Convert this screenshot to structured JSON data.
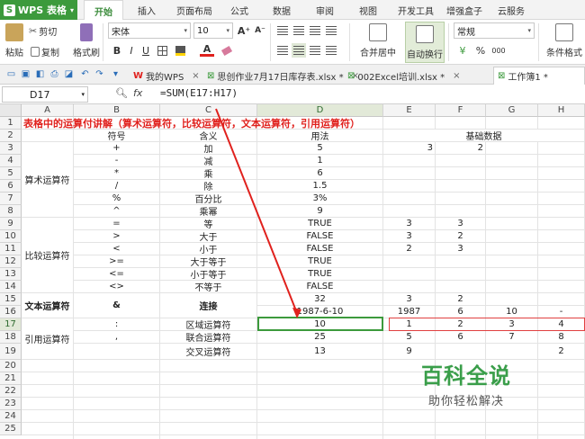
{
  "app": {
    "name": "WPS 表格",
    "logo": "S"
  },
  "menu_tabs": [
    {
      "label": "开始",
      "active": true
    },
    {
      "label": "插入"
    },
    {
      "label": "页面布局"
    },
    {
      "label": "公式"
    },
    {
      "label": "数据"
    },
    {
      "label": "审阅"
    },
    {
      "label": "视图"
    },
    {
      "label": "开发工具"
    },
    {
      "label": "增强盒子"
    },
    {
      "label": "云服务"
    }
  ],
  "ribbon": {
    "paste": "粘贴",
    "cut": "剪切",
    "copy": "复制",
    "format_painter": "格式刷",
    "font_name": "宋体",
    "font_size": "10",
    "grow_font": "A⁺",
    "shrink_font": "A⁻",
    "bold": "B",
    "italic": "I",
    "underline": "U",
    "merge_center": "合并居中",
    "wrap_text": "自动换行",
    "number_format": "常规",
    "percent": "%",
    "thousands": "000",
    "conditional_format": "条件格式"
  },
  "doc_tabs": [
    {
      "label": "我的WPS",
      "closable": true
    },
    {
      "label": "思创作业7月17日库存表.xlsx *",
      "closable": true
    },
    {
      "label": "002Excel培训.xlsx *",
      "closable": true
    },
    {
      "label": "工作簿1 *",
      "closable": false,
      "active": true
    }
  ],
  "formula_bar": {
    "cell": "D17",
    "fx": "fx",
    "formula": "=SUM(E17:H17)"
  },
  "columns": [
    "A",
    "B",
    "C",
    "D",
    "E",
    "F",
    "G",
    "H"
  ],
  "selected_column": "D",
  "rows": [
    "1",
    "2",
    "3",
    "4",
    "5",
    "6",
    "7",
    "8",
    "9",
    "10",
    "11",
    "12",
    "13",
    "14",
    "15",
    "16",
    "17",
    "18",
    "19",
    "20",
    "21",
    "22",
    "23",
    "24",
    "25"
  ],
  "selected_row": "17",
  "sheet": {
    "title": "表格中的运算付讲解（算术运算符，比较运算符，文本运算符，引用运算符）",
    "headers": {
      "symbol": "符号",
      "meaning": "含义",
      "usage": "用法",
      "base": "基础数据"
    },
    "groups": {
      "arith": "算术运算符",
      "compare": "比较运算符",
      "text": "文本运算符",
      "ref": "引用运算符"
    },
    "rows": [
      {
        "r": 3,
        "b": "+",
        "c": "加",
        "d": "5",
        "e": "3",
        "f": "2"
      },
      {
        "r": 4,
        "b": "-",
        "c": "减",
        "d": "1"
      },
      {
        "r": 5,
        "b": "*",
        "c": "乘",
        "d": "6"
      },
      {
        "r": 6,
        "b": "/",
        "c": "除",
        "d": "1.5"
      },
      {
        "r": 7,
        "b": "%",
        "c": "百分比",
        "d": "3%"
      },
      {
        "r": 8,
        "b": "^",
        "c": "乘幂",
        "d": "9"
      },
      {
        "r": 9,
        "b": "=",
        "c": "等",
        "d": "TRUE",
        "e": "3",
        "f": "3"
      },
      {
        "r": 10,
        "b": ">",
        "c": "大于",
        "d": "FALSE",
        "e": "3",
        "f": "2"
      },
      {
        "r": 11,
        "b": "<",
        "c": "小于",
        "d": "FALSE",
        "e": "2",
        "f": "3"
      },
      {
        "r": 12,
        "b": ">=",
        "c": "大于等于",
        "d": "TRUE"
      },
      {
        "r": 13,
        "b": "<=",
        "c": "小于等于",
        "d": "TRUE"
      },
      {
        "r": 14,
        "b": "<>",
        "c": "不等于",
        "d": "FALSE"
      },
      {
        "r": 15,
        "d": "32",
        "e": "3",
        "f": "2"
      },
      {
        "r": 16,
        "d": "1987-6-10",
        "e": "1987",
        "f": "6",
        "g": "10",
        "h": "-"
      },
      {
        "r": 17,
        "b": ":",
        "c": "区域运算符",
        "d": "10",
        "e": "1",
        "f": "2",
        "g": "3",
        "h": "4"
      },
      {
        "r": 18,
        "b": ",",
        "c": "联合运算符",
        "d": "25",
        "e": "5",
        "f": "6",
        "g": "7",
        "h": "8"
      },
      {
        "r": 19,
        "c": "交叉运算符",
        "d": "13",
        "e": "9",
        "h": "2"
      }
    ],
    "text_op": {
      "b": "&",
      "c": "连接"
    }
  },
  "watermark": {
    "main": "百科全说",
    "sub": "助你轻松解决"
  },
  "colors": {
    "accent": "#3c9a3c",
    "title_red": "#e0211d",
    "arrow_red": "#e0211d"
  }
}
